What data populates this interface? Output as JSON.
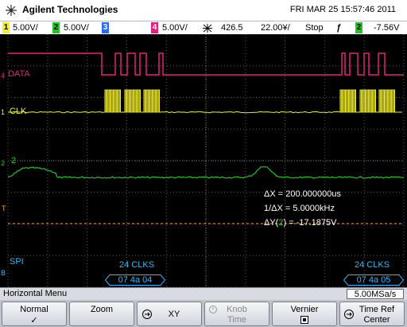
{
  "header": {
    "brand": "Agilent Technologies",
    "datetime": "FRI MAR 25 15:57:46 2011"
  },
  "status": {
    "ch1_num": "1",
    "ch1_scale": "5.00V/",
    "ch2_num": "2",
    "ch2_scale": "5.00V/",
    "ch3_num": "3",
    "ch4_num": "4",
    "ch4_scale": "5.00V/",
    "time_ref": "426.5",
    "time_scale": "22.00¥/",
    "run_state": "Stop",
    "trigger_slope": "ƒ",
    "trigger_source": "2",
    "trigger_level": "-7.56V"
  },
  "screen": {
    "labels": {
      "data": "DATA",
      "clk": "CLK",
      "ch2": "2",
      "spi": "SPI"
    },
    "markers": {
      "data": "4",
      "clk": "1",
      "ch2": "2",
      "trigger": "T",
      "spi": "B"
    },
    "measurements": {
      "dx": "ΔX = 200.000000us",
      "inv_dx": "1/ΔX = 5.0000kHz",
      "dy_prefix": "ΔY(",
      "dy_channel": "2",
      "dy_suffix": ") = -17.1875V"
    },
    "decode": {
      "frame1_clks": "24 CLKS",
      "frame1_hex": "07 4a 04",
      "frame2_clks": "24 CLKS",
      "frame2_hex": "07 4a 05"
    }
  },
  "menu": {
    "title": "Horizontal Menu",
    "sample_rate": "5.00MSa/s"
  },
  "softkeys": {
    "normal_l1": "Normal",
    "normal_l2": "✓",
    "zoom": "Zoom",
    "xy": "XY",
    "knob_l1": "Knob",
    "knob_l2": "Time",
    "vernier_l1": "Vernier",
    "timeref_l1": "Time Ref",
    "timeref_l2": "Center"
  },
  "colors": {
    "ch1": "#f2ee2a",
    "ch2": "#22c622",
    "ch3": "#2a6bff",
    "ch4": "#e6207c",
    "bus": "#2fb9ff",
    "grid": "#555555"
  }
}
